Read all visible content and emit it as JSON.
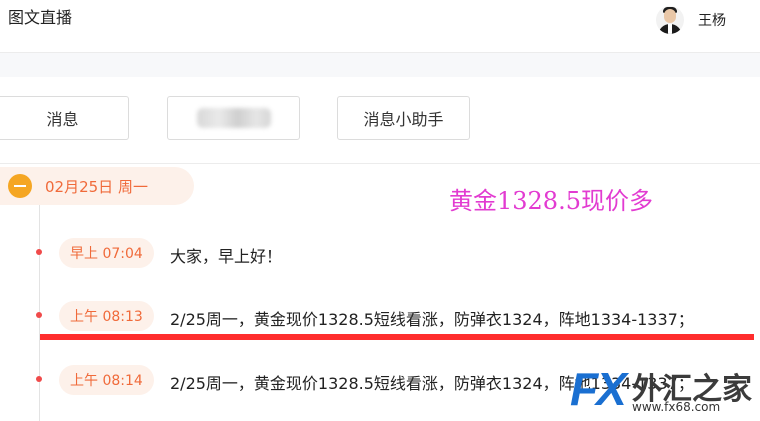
{
  "header": {
    "title": "图文直播",
    "user_name": "王杨"
  },
  "tabs": [
    {
      "label": "消息"
    },
    {
      "label": ""
    },
    {
      "label": "消息小助手"
    }
  ],
  "timeline": {
    "date_label": "02月25日 周一",
    "overlay_text": "黄金1328.5现价多",
    "messages": [
      {
        "time": "早上 07:04",
        "text": "大家，早上好！"
      },
      {
        "time": "上午 08:13",
        "text": "2/25周一，黄金现价1328.5短线看涨，防弹衣1324，阵地1334-1337；"
      },
      {
        "time": "上午 08:14",
        "text": "2/25周一，黄金现价1328.5短线看涨，防弹衣1324，阵地1334-1337；"
      }
    ]
  },
  "watermark": {
    "brand": "FX",
    "name": "外汇之家",
    "url": "www.fx68.com"
  },
  "colors": {
    "accent": "#f06a3a",
    "badge_bg": "#fdf1ea",
    "overlay": "#e23bd1",
    "underline": "#ff2d2d",
    "watermark_blue": "#1a6fd1"
  }
}
